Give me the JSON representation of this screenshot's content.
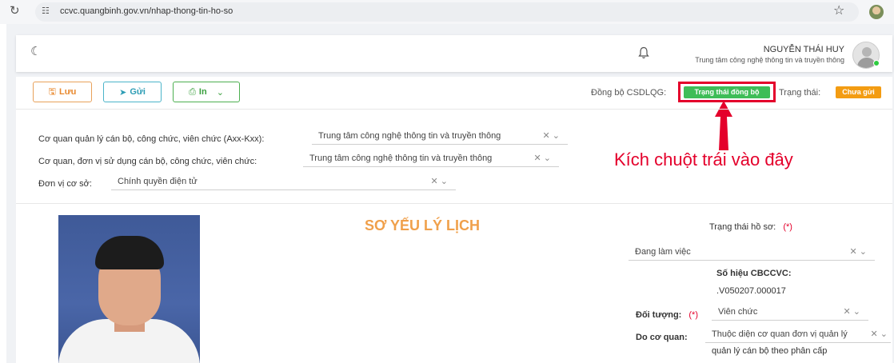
{
  "browser": {
    "url": "ccvc.quangbinh.gov.vn/nhap-thong-tin-ho-so"
  },
  "header": {
    "user_name": "NGUYỄN THÁI HUY",
    "user_org": "Trung tâm công nghệ thông tin và truyền thông"
  },
  "toolbar": {
    "save_label": "Lưu",
    "send_label": "Gửi",
    "print_label": "In"
  },
  "sync": {
    "label": "Đồng bộ CSDLQG:",
    "badge": "Trạng thái đồng bộ",
    "status_label": "Trạng thái:",
    "status_badge": "Chưa gửi"
  },
  "annotation": {
    "instruction": "Kích chuột trái vào đây",
    "color": "#e4002b"
  },
  "form": {
    "agency_label": "Cơ quan quản lý cán bộ, công chức, viên chức (Axx-Kxx):",
    "agency_value": "Trung tâm công nghệ thông tin và truyền thông",
    "unit_label": "Cơ quan, đơn vị sử dụng cán bộ, công chức, viên chức:",
    "unit_value": "Trung tâm công nghệ thông tin và truyền thông",
    "base_label": "Đơn vị cơ sở:",
    "base_value": "Chính quyền điện tử"
  },
  "profile": {
    "title": "SƠ YẾU LÝ LỊCH",
    "status_label": "Trạng thái hồ sơ:",
    "required": "(*)",
    "status_value": "Đang làm việc",
    "code_label": "Số hiệu CBCCVC:",
    "code_value": ".V050207.000017",
    "target_label": "Đối tượng:",
    "target_value": "Viên chức",
    "managed_label": "Do cơ quan:",
    "managed_value": "Thuộc diện cơ quan đơn vị quản lý",
    "managed_extra": "quản lý cán bộ theo phân cấp"
  },
  "colors": {
    "save": "#e8892f",
    "send": "#2d9db5",
    "print": "#3a9f3e",
    "sync_badge": "#3ebd57",
    "status_badge": "#f39c12",
    "title": "#f0a04b"
  },
  "icons": {
    "reload": "reload-icon",
    "star": "star-icon",
    "moon": "moon-icon",
    "bell": "bell-icon",
    "save": "save-icon",
    "send": "send-icon",
    "print": "print-icon"
  }
}
